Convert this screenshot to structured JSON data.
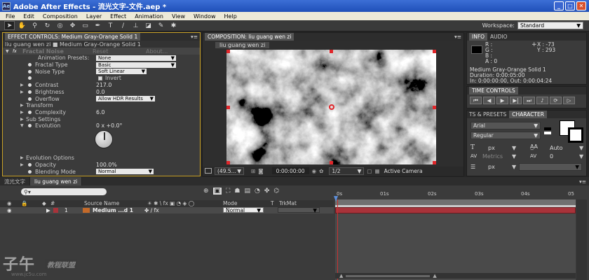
{
  "window": {
    "title": "Adobe After Effects - 流光文字-文件.aep *",
    "app_icon": "Ae"
  },
  "menu": [
    "File",
    "Edit",
    "Composition",
    "Layer",
    "Effect",
    "Animation",
    "View",
    "Window",
    "Help"
  ],
  "toolbar": {
    "workspace_label": "Workspace:",
    "workspace_value": "Standard"
  },
  "effect_controls": {
    "tab": "EFFECT CONTROLS: Medium Gray-Orange Solid 1",
    "breadcrumb": "liu guang wen zi ■ Medium Gray-Orange Solid 1",
    "effect_name": "Fractal Noise",
    "reset": "Reset",
    "about": "About...",
    "rows": [
      {
        "label": "Animation Presets:",
        "value": "None",
        "kind": "dropdown"
      },
      {
        "label": "Fractal Type",
        "value": "Basic",
        "kind": "dropdown"
      },
      {
        "label": "Noise Type",
        "value": "Soft Linear",
        "kind": "dropdown"
      },
      {
        "label": "",
        "value": "Invert",
        "kind": "checkbox"
      },
      {
        "label": "Contrast",
        "value": "217.0",
        "kind": "value"
      },
      {
        "label": "Brightness",
        "value": "0.0",
        "kind": "value"
      },
      {
        "label": "Overflow",
        "value": "Allow HDR Results",
        "kind": "dropdown"
      },
      {
        "label": "Transform",
        "value": "",
        "kind": "group"
      },
      {
        "label": "Complexity",
        "value": "6.0",
        "kind": "value"
      },
      {
        "label": "Sub Settings",
        "value": "",
        "kind": "group"
      },
      {
        "label": "Evolution",
        "value": "0 x +0.0°",
        "kind": "value"
      }
    ],
    "rows2": [
      {
        "label": "Evolution Options",
        "value": "",
        "kind": "group"
      },
      {
        "label": "Opacity",
        "value": "100.0%",
        "kind": "value"
      },
      {
        "label": "Blending Mode",
        "value": "Normal",
        "kind": "dropdown"
      }
    ]
  },
  "composition": {
    "tab": "COMPOSITION: liu guang wen zi",
    "subtab": "liu guang wen zi",
    "zoom": "(49.5...",
    "timecode": "0:00:00:00",
    "resolution": "1/2",
    "camera": "Active Camera"
  },
  "info": {
    "tabs": [
      "INFO",
      "AUDIO"
    ],
    "r": "R :",
    "g": "G :",
    "b": "B :",
    "a": "A : 0",
    "x": "X : -73",
    "y": "Y : 293",
    "layer": "Medium Gray-Orange Solid 1",
    "duration": "Duration: 0:00:05:00",
    "inout": "In: 0:00:00:00, Out: 0:00:04:24"
  },
  "time_controls": {
    "tab": "TIME CONTROLS"
  },
  "character": {
    "tabs": [
      "TS & PRESETS",
      "CHARACTER"
    ],
    "font": "Arial",
    "style": "Regular",
    "size_unit": "px",
    "leading": "Auto",
    "metrics": "Metrics",
    "tracking": "0",
    "stroke_unit": "px"
  },
  "timeline": {
    "tabs": [
      "流光文字",
      "liu guang wen zi"
    ],
    "columns": {
      "source": "Source Name",
      "mode": "Mode",
      "t": "T",
      "trkmat": "TrkMat"
    },
    "layer": {
      "index": "1",
      "name": "Medium ...d 1",
      "mode": "Normal"
    },
    "ticks": [
      "0s",
      "01s",
      "02s",
      "03s",
      "04s",
      "05"
    ]
  },
  "watermark": {
    "logo": "子午",
    "badge": "教程联盟",
    "url": "www.jc5u.com"
  },
  "colors": {
    "layer_bar": "#a8333a",
    "solid_chip": "#c46a2a",
    "handles": "#e0262a",
    "playhead": "#c83030"
  }
}
